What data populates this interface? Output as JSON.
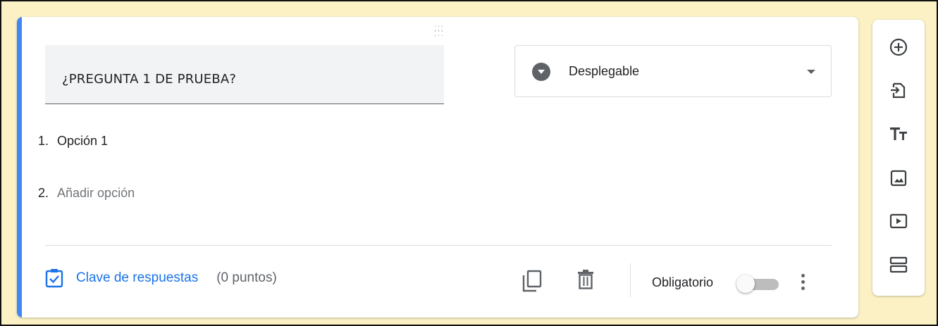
{
  "question": {
    "title": "¿PREGUNTA 1 DE PRUEBA?",
    "type": "Desplegable"
  },
  "options": [
    {
      "number": "1.",
      "label": "Opción 1"
    },
    {
      "number": "2.",
      "label": "Añadir opción"
    }
  ],
  "footer": {
    "answer_key_label": "Clave de respuestas",
    "points_label": "(0 puntos)",
    "required_label": "Obligatorio",
    "required_on": false
  },
  "icons": {
    "drag": "drag-handle-icon",
    "answer_key": "checklist-icon",
    "duplicate": "copy-icon",
    "delete": "trash-icon",
    "more": "more-vert-icon",
    "toolbar": [
      "add-circle-icon",
      "import-icon",
      "title-text-icon",
      "image-icon",
      "video-icon",
      "section-icon"
    ]
  },
  "colors": {
    "accent": "#4285f4",
    "link": "#1a73e8",
    "background": "#fbf1c5"
  }
}
